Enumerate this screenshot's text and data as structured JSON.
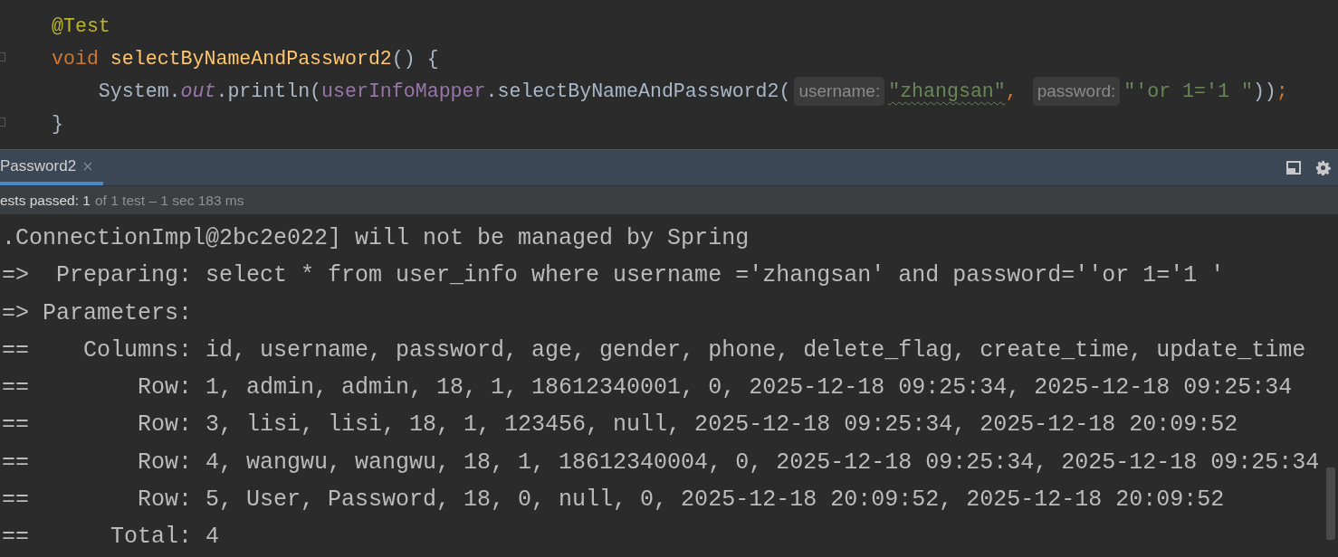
{
  "editor": {
    "lines": [
      [
        {
          "kind": "annotation",
          "text": "@Test"
        }
      ],
      [
        {
          "kind": "keyword",
          "text": "void "
        },
        {
          "kind": "method",
          "text": "selectByNameAndPassword2"
        },
        {
          "kind": "plain",
          "text": "() {"
        }
      ],
      [
        {
          "kind": "plain",
          "text": "    System."
        },
        {
          "kind": "static",
          "text": "out"
        },
        {
          "kind": "plain",
          "text": ".println("
        },
        {
          "kind": "field",
          "text": "userInfoMapper"
        },
        {
          "kind": "plain",
          "text": ".selectByNameAndPassword2("
        },
        {
          "kind": "hint",
          "text": "username:"
        },
        {
          "kind": "string",
          "text": "\"zhangsan\"",
          "underlined": true
        },
        {
          "kind": "keyword",
          "text": ", "
        },
        {
          "kind": "hint",
          "text": "password:"
        },
        {
          "kind": "string",
          "text": "\"'or 1='1 \"",
          "underlined": false
        },
        {
          "kind": "plain",
          "text": "))"
        },
        {
          "kind": "keyword",
          "text": ";"
        }
      ],
      [
        {
          "kind": "plain",
          "text": "}"
        }
      ]
    ]
  },
  "run_panel": {
    "tabs": [
      {
        "label": "Password2",
        "selected": true
      }
    ],
    "status": {
      "summary": "ests passed: 1",
      "detail": "of 1 test – 1 sec 183 ms"
    },
    "console": [
      ".ConnectionImpl@2bc2e022] will not be managed by Spring",
      "=>  Preparing: select * from user_info where username ='zhangsan' and password=''or 1='1 '",
      "=> Parameters: ",
      "==    Columns: id, username, password, age, gender, phone, delete_flag, create_time, update_time",
      "==        Row: 1, admin, admin, 18, 1, 18612340001, 0, 2025-12-18 09:25:34, 2025-12-18 09:25:34",
      "==        Row: 3, lisi, lisi, 18, 1, 123456, null, 2025-12-18 09:25:34, 2025-12-18 20:09:52",
      "==        Row: 4, wangwu, wangwu, 18, 1, 18612340004, 0, 2025-12-18 09:25:34, 2025-12-18 09:25:34",
      "==        Row: 5, User, Password, 18, 0, null, 0, 2025-12-18 20:09:52, 2025-12-18 20:09:52",
      "==      Total: 4"
    ]
  }
}
